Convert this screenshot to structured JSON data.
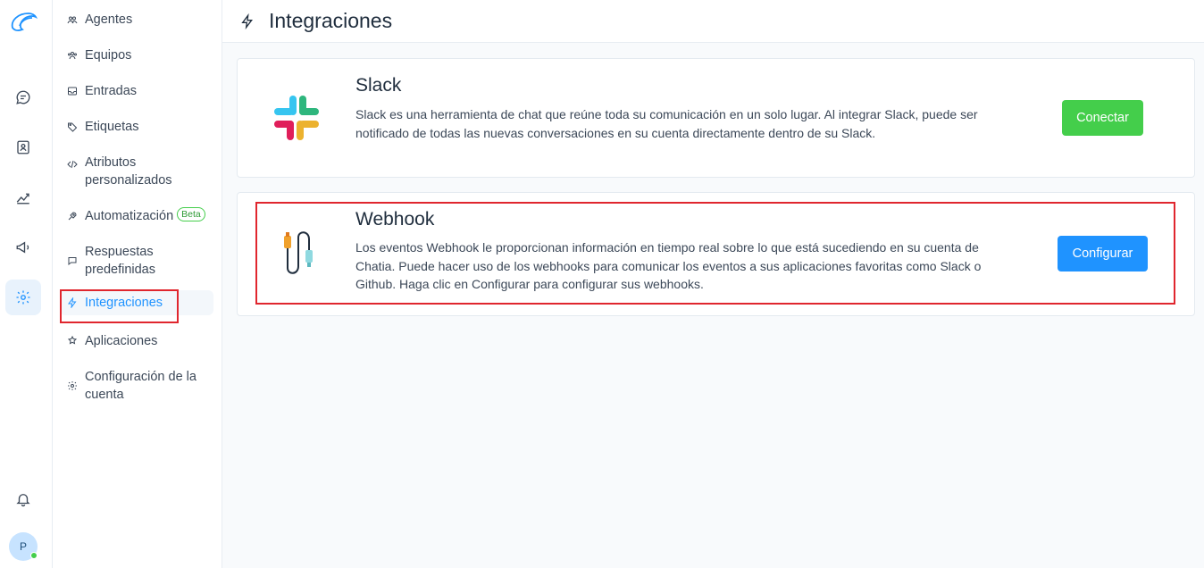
{
  "rail": {
    "icons": [
      "logo-icon",
      "conversations-icon",
      "contacts-icon",
      "reports-icon",
      "campaigns-icon",
      "settings-icon",
      "notifications-icon"
    ],
    "avatar_initial": "P"
  },
  "sidebar": {
    "items": [
      {
        "label": "Agentes",
        "icon": "agents-icon"
      },
      {
        "label": "Equipos",
        "icon": "teams-icon"
      },
      {
        "label": "Entradas",
        "icon": "inboxes-icon"
      },
      {
        "label": "Etiquetas",
        "icon": "labels-icon"
      },
      {
        "label": "Atributos personalizados",
        "icon": "code-icon"
      },
      {
        "label": "Automatización",
        "icon": "automation-icon",
        "badge": "Beta"
      },
      {
        "label": "Respuestas predefinidas",
        "icon": "canned-responses-icon"
      },
      {
        "label": "Integraciones",
        "icon": "lightning-icon",
        "active": true
      },
      {
        "label": "Aplicaciones",
        "icon": "apps-icon"
      },
      {
        "label": "Configuración de la cuenta",
        "icon": "settings-icon"
      }
    ]
  },
  "header": {
    "title": "Integraciones",
    "icon": "lightning-icon"
  },
  "integrations": [
    {
      "name": "Slack",
      "description": "Slack es una herramienta de chat que reúne toda su comunicación en un solo lugar. Al integrar Slack, puede ser notificado de todas las nuevas conversaciones en su cuenta directamente dentro de su Slack.",
      "button": "Conectar"
    },
    {
      "name": "Webhook",
      "description": "Los eventos Webhook le proporcionan información en tiempo real sobre lo que está sucediendo en su cuenta de Chatia. Puede hacer uso de los webhooks para comunicar los eventos a sus aplicaciones favoritas como Slack o Github. Haga clic en Configurar para configurar sus webhooks.",
      "button": "Configurar"
    }
  ],
  "colors": {
    "primary": "#1f93ff",
    "success": "#44ce4b",
    "highlight": "#e0262e"
  }
}
